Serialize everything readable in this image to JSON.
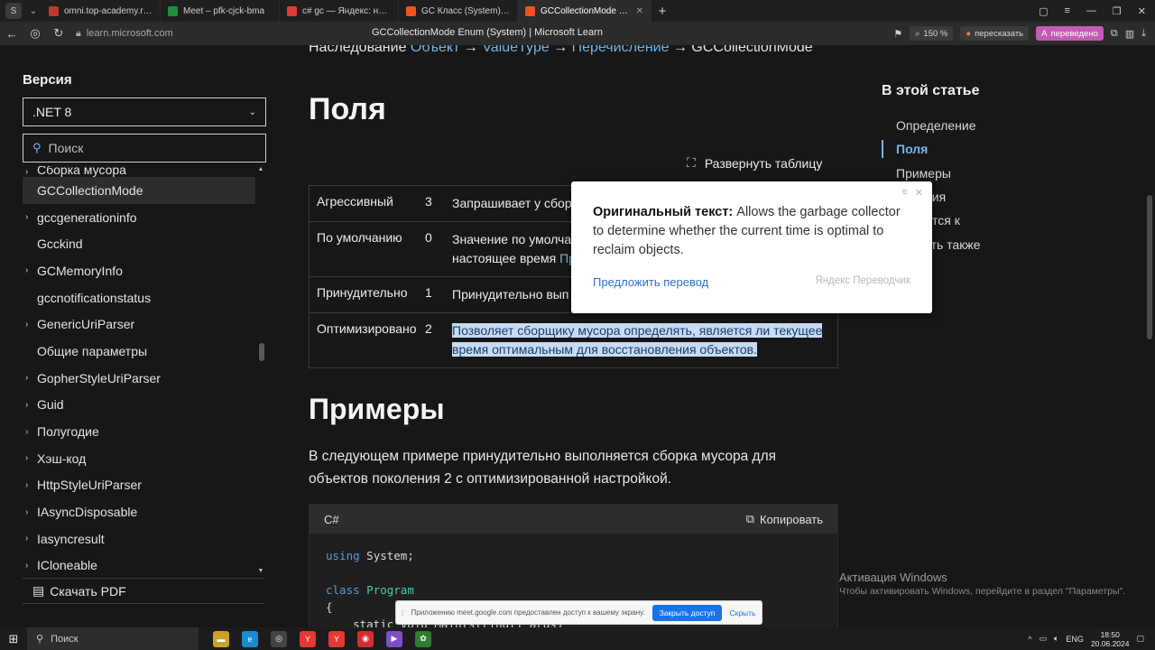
{
  "browser": {
    "tabs": [
      {
        "title": "omni.top-academy.ru/#/p",
        "color": "#c0392b",
        "active": false
      },
      {
        "title": "Meet – pfk-cjck-bma",
        "color": "#1e8e3e",
        "active": false
      },
      {
        "title": "c# gc — Яндекс: нашлось",
        "color": "#e53935",
        "active": false
      },
      {
        "title": "GC Класс (System) | Micr",
        "color": "#f25022",
        "active": false
      },
      {
        "title": "GCCollectionMode Enum",
        "color": "#f25022",
        "active": true
      }
    ],
    "url": "learn.microsoft.com",
    "page_title": "GCCollectionMode Enum (System) | Microsoft Learn",
    "zoom": "150 %",
    "retell_label": "пересказать",
    "translated_label": "переведено"
  },
  "sidebar": {
    "version_title": "Версия",
    "version_value": ".NET 8",
    "search_placeholder": "Поиск",
    "items": [
      {
        "label": "Сборка мусора",
        "caret": true,
        "selected": false
      },
      {
        "label": "GCCollectionMode",
        "caret": false,
        "selected": true
      },
      {
        "label": "gccgenerationinfo",
        "caret": true,
        "selected": false
      },
      {
        "label": "Gcckind",
        "caret": false,
        "selected": false
      },
      {
        "label": "GCMemoryInfo",
        "caret": true,
        "selected": false
      },
      {
        "label": "gccnotificationstatus",
        "caret": false,
        "selected": false
      },
      {
        "label": "GenericUriParser",
        "caret": true,
        "selected": false
      },
      {
        "label": "Общие параметры",
        "caret": false,
        "selected": false
      },
      {
        "label": "GopherStyleUriParser",
        "caret": true,
        "selected": false
      },
      {
        "label": "Guid",
        "caret": true,
        "selected": false
      },
      {
        "label": "Полугодие",
        "caret": true,
        "selected": false
      },
      {
        "label": "Хэш-код",
        "caret": true,
        "selected": false
      },
      {
        "label": "HttpStyleUriParser",
        "caret": true,
        "selected": false
      },
      {
        "label": "IAsyncDisposable",
        "caret": true,
        "selected": false
      },
      {
        "label": "Iasyncresult",
        "caret": true,
        "selected": false
      },
      {
        "label": "ICloneable",
        "caret": true,
        "selected": false
      }
    ],
    "download_pdf": "Скачать PDF"
  },
  "main": {
    "inherit_prefix": "Наследование",
    "inherit_object": "Объект",
    "inherit_valuetype": "ValueType",
    "inherit_enum": "Перечисление",
    "inherit_current": "GCCollectionMode",
    "arrow": "→",
    "fields_heading": "Поля",
    "expand_table": "Развернуть таблицу",
    "fields": [
      {
        "name": "Агрессивный",
        "value": "3",
        "desc": "Запрашивает у сбор",
        "link": ""
      },
      {
        "name": "По умолчанию",
        "value": "0",
        "desc": "Значение по умолча",
        "desc2": "настоящее время ",
        "link": "Пр"
      },
      {
        "name": "Принудительно",
        "value": "1",
        "desc": "Принудительно вып",
        "link": ""
      },
      {
        "name": "Оптимизировано",
        "value": "2",
        "desc": "Позволяет сборщику мусора определять, является ли текущее",
        "desc2": "время оптимальным для восстановления объектов.",
        "link": ""
      }
    ],
    "examples_heading": "Примеры",
    "examples_para": "В следующем примере принудительно выполняется сборка мусора для объектов поколения 2 с оптимизированной настройкой.",
    "code_lang": "C#",
    "copy_label": "Копировать",
    "code_lines": [
      {
        "kw": "using",
        "rest": " System;"
      },
      {
        "kw": "",
        "rest": ""
      },
      {
        "kw": "class",
        "ty": " Program",
        "rest": ""
      },
      {
        "kw": "",
        "rest": "{"
      },
      {
        "kw": "",
        "rest": "    static void Main(string[] args)"
      }
    ]
  },
  "right_toc": {
    "title": "В этой статье",
    "items": [
      {
        "label": "Определение",
        "active": false
      },
      {
        "label": "Поля",
        "active": true
      },
      {
        "label": "Примеры",
        "active": false
      },
      {
        "label": "мечания",
        "active": false
      },
      {
        "label": "меняется к",
        "active": false
      },
      {
        "label": "мотреть также",
        "active": false
      }
    ]
  },
  "translate_popup": {
    "label": "Оригинальный текст:",
    "text": " Allows the garbage collector to determine whether the current time is optimal to reclaim objects.",
    "suggest": "Предложить перевод",
    "brand": "Яндекс Переводчик"
  },
  "windows_activation": {
    "title": "Активация Windows",
    "subtitle": "Чтобы активировать Windows, перейдите в раздел \"Параметры\"."
  },
  "meet_bar": {
    "text": "Приложению meet.google.com предоставлен доступ к вашему экрану.",
    "stop": "Закрыть доступ",
    "hide": "Скрыть"
  },
  "taskbar": {
    "search": "Поиск",
    "lang": "ENG",
    "time": "18:50",
    "date": "20.06.2024"
  }
}
